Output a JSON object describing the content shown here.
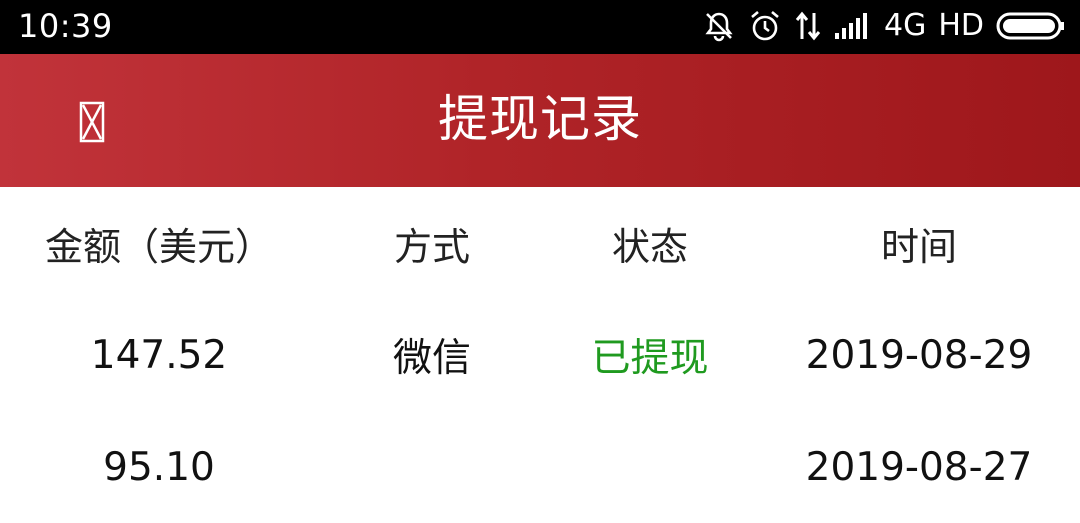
{
  "status_bar": {
    "time": "10:39",
    "network": "4G",
    "hd": "HD",
    "icons": [
      "bell-off-icon",
      "alarm-icon",
      "data-arrows-icon",
      "signal-icon",
      "battery-icon"
    ]
  },
  "header": {
    "title": "提现记录",
    "back_icon": "back-icon",
    "colors": {
      "start": "#c1333a",
      "end": "#9e171b"
    }
  },
  "table": {
    "columns": [
      "金额（美元）",
      "方式",
      "状态",
      "时间"
    ],
    "rows": [
      {
        "amount": "147.52",
        "method": "微信",
        "status": "已提现",
        "date": "2019-08-29"
      },
      {
        "amount": "95.10",
        "method": "",
        "status": "",
        "date": "2019-08-27"
      }
    ],
    "status_color": "#1f9a1f"
  }
}
